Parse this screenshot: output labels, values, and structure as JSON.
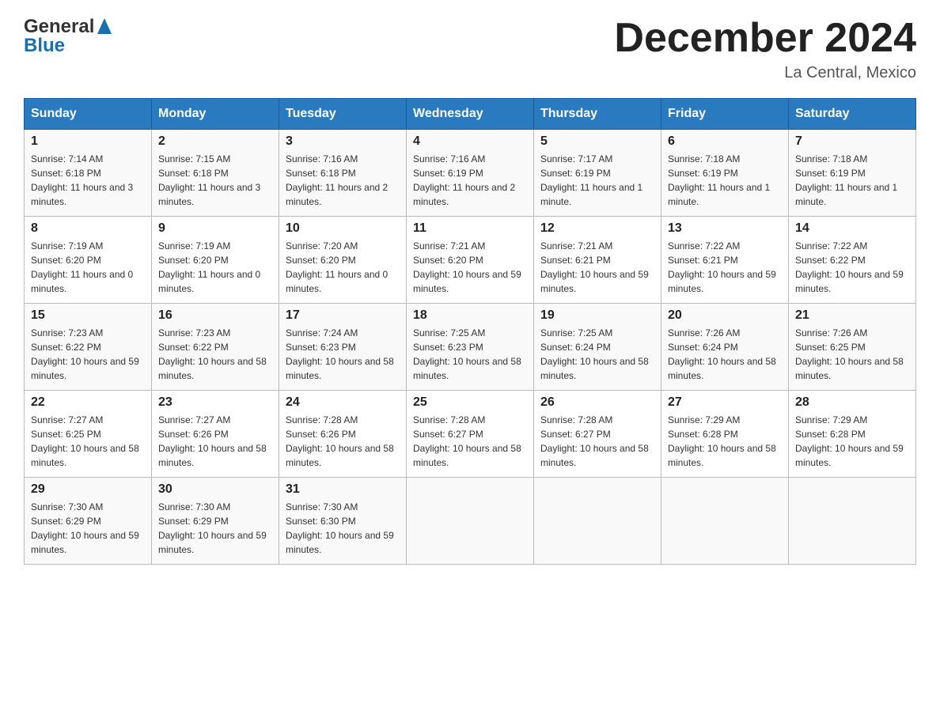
{
  "header": {
    "logo_general": "General",
    "logo_blue": "Blue",
    "title": "December 2024",
    "location": "La Central, Mexico"
  },
  "days_of_week": [
    "Sunday",
    "Monday",
    "Tuesday",
    "Wednesday",
    "Thursday",
    "Friday",
    "Saturday"
  ],
  "weeks": [
    [
      {
        "day": "1",
        "sunrise": "7:14 AM",
        "sunset": "6:18 PM",
        "daylight": "11 hours and 3 minutes."
      },
      {
        "day": "2",
        "sunrise": "7:15 AM",
        "sunset": "6:18 PM",
        "daylight": "11 hours and 3 minutes."
      },
      {
        "day": "3",
        "sunrise": "7:16 AM",
        "sunset": "6:18 PM",
        "daylight": "11 hours and 2 minutes."
      },
      {
        "day": "4",
        "sunrise": "7:16 AM",
        "sunset": "6:19 PM",
        "daylight": "11 hours and 2 minutes."
      },
      {
        "day": "5",
        "sunrise": "7:17 AM",
        "sunset": "6:19 PM",
        "daylight": "11 hours and 1 minute."
      },
      {
        "day": "6",
        "sunrise": "7:18 AM",
        "sunset": "6:19 PM",
        "daylight": "11 hours and 1 minute."
      },
      {
        "day": "7",
        "sunrise": "7:18 AM",
        "sunset": "6:19 PM",
        "daylight": "11 hours and 1 minute."
      }
    ],
    [
      {
        "day": "8",
        "sunrise": "7:19 AM",
        "sunset": "6:20 PM",
        "daylight": "11 hours and 0 minutes."
      },
      {
        "day": "9",
        "sunrise": "7:19 AM",
        "sunset": "6:20 PM",
        "daylight": "11 hours and 0 minutes."
      },
      {
        "day": "10",
        "sunrise": "7:20 AM",
        "sunset": "6:20 PM",
        "daylight": "11 hours and 0 minutes."
      },
      {
        "day": "11",
        "sunrise": "7:21 AM",
        "sunset": "6:20 PM",
        "daylight": "10 hours and 59 minutes."
      },
      {
        "day": "12",
        "sunrise": "7:21 AM",
        "sunset": "6:21 PM",
        "daylight": "10 hours and 59 minutes."
      },
      {
        "day": "13",
        "sunrise": "7:22 AM",
        "sunset": "6:21 PM",
        "daylight": "10 hours and 59 minutes."
      },
      {
        "day": "14",
        "sunrise": "7:22 AM",
        "sunset": "6:22 PM",
        "daylight": "10 hours and 59 minutes."
      }
    ],
    [
      {
        "day": "15",
        "sunrise": "7:23 AM",
        "sunset": "6:22 PM",
        "daylight": "10 hours and 59 minutes."
      },
      {
        "day": "16",
        "sunrise": "7:23 AM",
        "sunset": "6:22 PM",
        "daylight": "10 hours and 58 minutes."
      },
      {
        "day": "17",
        "sunrise": "7:24 AM",
        "sunset": "6:23 PM",
        "daylight": "10 hours and 58 minutes."
      },
      {
        "day": "18",
        "sunrise": "7:25 AM",
        "sunset": "6:23 PM",
        "daylight": "10 hours and 58 minutes."
      },
      {
        "day": "19",
        "sunrise": "7:25 AM",
        "sunset": "6:24 PM",
        "daylight": "10 hours and 58 minutes."
      },
      {
        "day": "20",
        "sunrise": "7:26 AM",
        "sunset": "6:24 PM",
        "daylight": "10 hours and 58 minutes."
      },
      {
        "day": "21",
        "sunrise": "7:26 AM",
        "sunset": "6:25 PM",
        "daylight": "10 hours and 58 minutes."
      }
    ],
    [
      {
        "day": "22",
        "sunrise": "7:27 AM",
        "sunset": "6:25 PM",
        "daylight": "10 hours and 58 minutes."
      },
      {
        "day": "23",
        "sunrise": "7:27 AM",
        "sunset": "6:26 PM",
        "daylight": "10 hours and 58 minutes."
      },
      {
        "day": "24",
        "sunrise": "7:28 AM",
        "sunset": "6:26 PM",
        "daylight": "10 hours and 58 minutes."
      },
      {
        "day": "25",
        "sunrise": "7:28 AM",
        "sunset": "6:27 PM",
        "daylight": "10 hours and 58 minutes."
      },
      {
        "day": "26",
        "sunrise": "7:28 AM",
        "sunset": "6:27 PM",
        "daylight": "10 hours and 58 minutes."
      },
      {
        "day": "27",
        "sunrise": "7:29 AM",
        "sunset": "6:28 PM",
        "daylight": "10 hours and 58 minutes."
      },
      {
        "day": "28",
        "sunrise": "7:29 AM",
        "sunset": "6:28 PM",
        "daylight": "10 hours and 59 minutes."
      }
    ],
    [
      {
        "day": "29",
        "sunrise": "7:30 AM",
        "sunset": "6:29 PM",
        "daylight": "10 hours and 59 minutes."
      },
      {
        "day": "30",
        "sunrise": "7:30 AM",
        "sunset": "6:29 PM",
        "daylight": "10 hours and 59 minutes."
      },
      {
        "day": "31",
        "sunrise": "7:30 AM",
        "sunset": "6:30 PM",
        "daylight": "10 hours and 59 minutes."
      },
      null,
      null,
      null,
      null
    ]
  ]
}
